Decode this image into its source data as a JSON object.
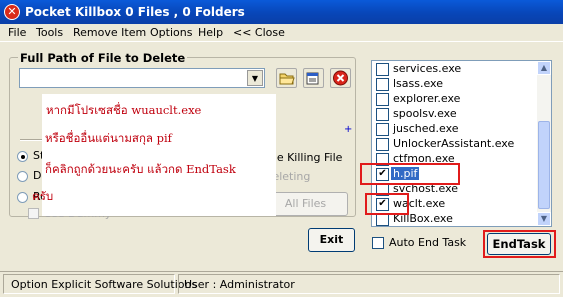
{
  "window": {
    "title": "Pocket Killbox  0 Files , 0 Folders"
  },
  "menu": [
    {
      "label": "File"
    },
    {
      "label": "Tools"
    },
    {
      "label": "Remove Item"
    },
    {
      "label": "Options"
    },
    {
      "label": "Help"
    },
    {
      "label": "<< Close"
    }
  ],
  "left_panel": {
    "group_title": "Full Path of File to Delete",
    "path_value": "",
    "radios": [
      {
        "label": "St",
        "selected": true
      },
      {
        "label": "De",
        "selected": false
      },
      {
        "label": "Re",
        "selected": false
      }
    ],
    "kill_label": "mile Killing File",
    "deleting_label": "Deleting",
    "use_dummy_label": "Use Dummy",
    "all_files_label": "All Files",
    "exit_label": "Exit",
    "plus": "+"
  },
  "note_overlay": {
    "lines": [
      "หากมีโปรเซสชื่อ  wuauclt.exe",
      "หรือชื่ออื่นแต่นามสกุล pif",
      "ก็คลิกถูกด้วยนะครับ แล้วกด EndTask",
      "ครับ"
    ]
  },
  "process_list": {
    "items": [
      {
        "name": "services.exe",
        "checked": false,
        "selected": false
      },
      {
        "name": "lsass.exe",
        "checked": false,
        "selected": false
      },
      {
        "name": "explorer.exe",
        "checked": false,
        "selected": false
      },
      {
        "name": "spoolsv.exe",
        "checked": false,
        "selected": false
      },
      {
        "name": "jusched.exe",
        "checked": false,
        "selected": false
      },
      {
        "name": "UnlockerAssistant.exe",
        "checked": false,
        "selected": false
      },
      {
        "name": "ctfmon.exe",
        "checked": false,
        "selected": false
      },
      {
        "name": "h.pif",
        "checked": true,
        "selected": true
      },
      {
        "name": "svchost.exe",
        "checked": false,
        "selected": false
      },
      {
        "name": "waclt.exe",
        "checked": true,
        "selected": false
      },
      {
        "name": "KillBox.exe",
        "checked": false,
        "selected": false
      }
    ],
    "auto_end_task_label": "Auto End Task",
    "end_task_label": "EndTask"
  },
  "status_bar": {
    "company": "Option Explicit Software Solutions",
    "user": "User : Administrator"
  },
  "colors": {
    "title_bar": "#0846b8",
    "selection": "#316ac5",
    "highlight_box": "#e11b1b",
    "note_text": "#c0000e"
  }
}
